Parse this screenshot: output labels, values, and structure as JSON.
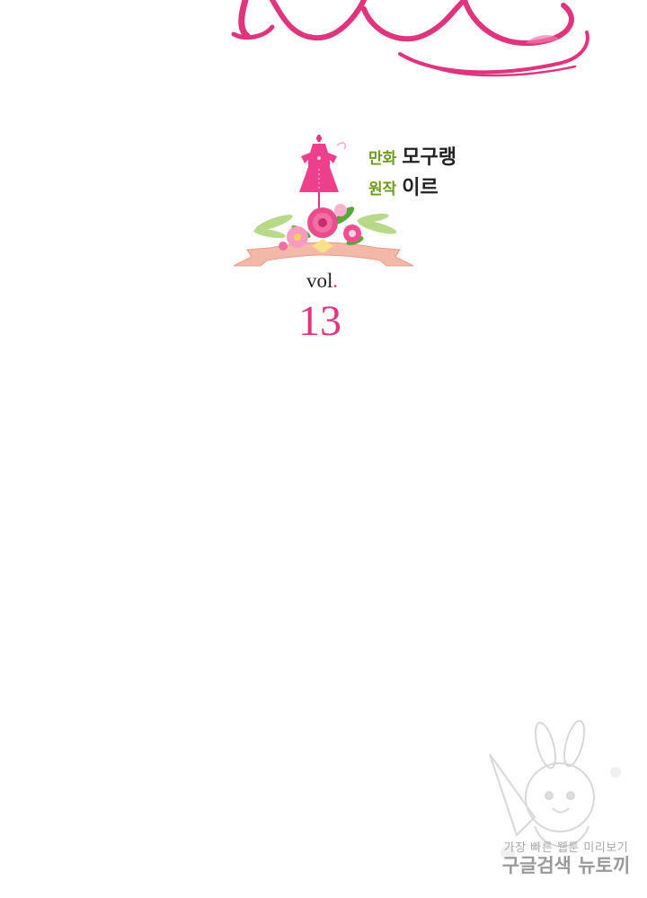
{
  "credits": {
    "art_role": "만화",
    "art_name": "모구랭",
    "story_role": "원작",
    "story_name": "이르"
  },
  "volume": {
    "label": "vol",
    "dot": ".",
    "number": "13"
  },
  "watermark": {
    "line1": "가장 빠른 웹툰 미리보기",
    "line2": "구글검색 뉴토끼"
  },
  "colors": {
    "accent_pink": "#e0347c",
    "credit_role_green": "#6e9a1e",
    "text_dark": "#222222",
    "ribbon_peach": "#f4b8a8"
  }
}
